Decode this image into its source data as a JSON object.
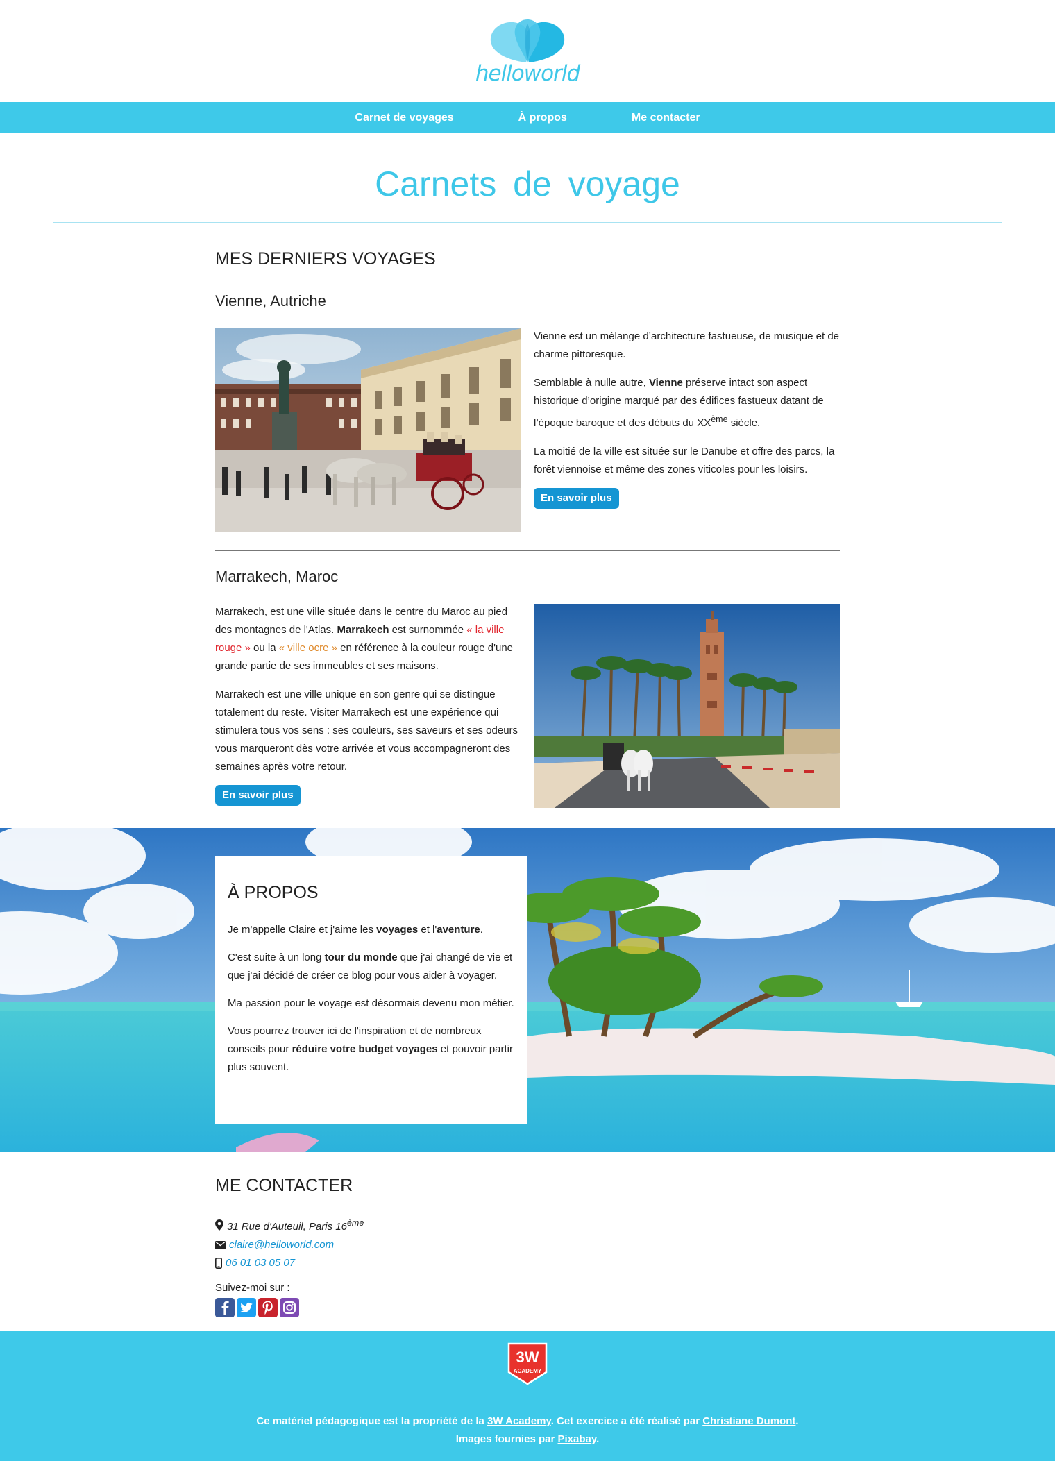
{
  "brand": {
    "logo_text": "helloworld"
  },
  "nav": {
    "items": [
      "Carnet de voyages",
      "À propos",
      "Me contacter"
    ]
  },
  "page_title": "Carnets de voyage",
  "latest": {
    "heading": "MES DERNIERS VOYAGES",
    "vienne": {
      "title": "Vienne, Autriche",
      "p1": "Vienne est un mélange d’architecture fastueuse, de musique et de charme pittoresque.",
      "p2_a": "Semblable à nulle autre, ",
      "p2_b": "Vienne",
      "p2_c": " préserve intact son aspect historique d’origine marqué par des édifices fastueux datant de l’époque baroque et des débuts du XX",
      "p2_sup": "ème",
      "p2_d": " siècle.",
      "p3": "La moitié de la ville est située sur le Danube et offre des parcs, la forêt viennoise et même des zones viticoles pour les loisirs.",
      "button": "En savoir plus"
    },
    "marrakech": {
      "title": "Marrakech, Maroc",
      "p1_a": "Marrakech, est une ville située dans le centre du Maroc au pied des montagnes de l'Atlas. ",
      "p1_b": "Marrakech",
      "p1_c": " est surnommée ",
      "p1_red": "« la ville rouge »",
      "p1_d": " ou la ",
      "p1_ocre": "« ville ocre »",
      "p1_e": " en référence à la couleur rouge d'une grande partie de ses immeubles et ses maisons.",
      "p2": "Marrakech est une ville unique en son genre qui se distingue totalement du reste. Visiter Marrakech est une expérience qui stimulera tous vos sens : ses couleurs, ses saveurs et ses odeurs vous marqueront dès votre arrivée et vous accompagneront des semaines après votre retour.",
      "button": "En savoir plus"
    }
  },
  "about": {
    "heading": "À PROPOS",
    "p1_a": "Je m'appelle Claire et j'aime les ",
    "p1_b": "voyages",
    "p1_c": " et l'",
    "p1_d": "aventure",
    "p1_e": ".",
    "p2_a": "C'est suite à un long ",
    "p2_b": "tour du monde",
    "p2_c": " que j'ai changé de vie et que j'ai décidé de créer ce blog pour vous aider à voyager.",
    "p3": "Ma passion pour le voyage est désormais devenu mon métier.",
    "p4_a": "Vous pourrez trouver ici de l'inspiration et de nombreux conseils pour ",
    "p4_b": "réduire votre budget voyages",
    "p4_c": " et pouvoir partir plus souvent."
  },
  "contact": {
    "heading": "ME CONTACTER",
    "address": "31 Rue d'Auteuil, Paris 16",
    "address_sup": "ème",
    "email": "claire@helloworld.com",
    "phone": "06 01 03 05 07",
    "follow": "Suivez-moi sur :",
    "socials": [
      "facebook-icon",
      "twitter-icon",
      "pinterest-icon",
      "instagram-icon"
    ]
  },
  "footer": {
    "badge_top": "3W",
    "badge_bottom": "ACADEMY",
    "line1_a": "Ce matériel pédagogique est la propriété de la ",
    "line1_link": "3W Academy",
    "line1_b": ". Cet exercice a été réalisé par ",
    "line1_author": "Christiane Dumont",
    "line1_c": ".",
    "line2_a": "Images fournies par ",
    "line2_link": "Pixabay",
    "line2_b": "."
  },
  "colors": {
    "accent": "#3ec9e9",
    "button": "#1595d3",
    "red": "#e0242c",
    "ocre": "#df8a2c"
  }
}
